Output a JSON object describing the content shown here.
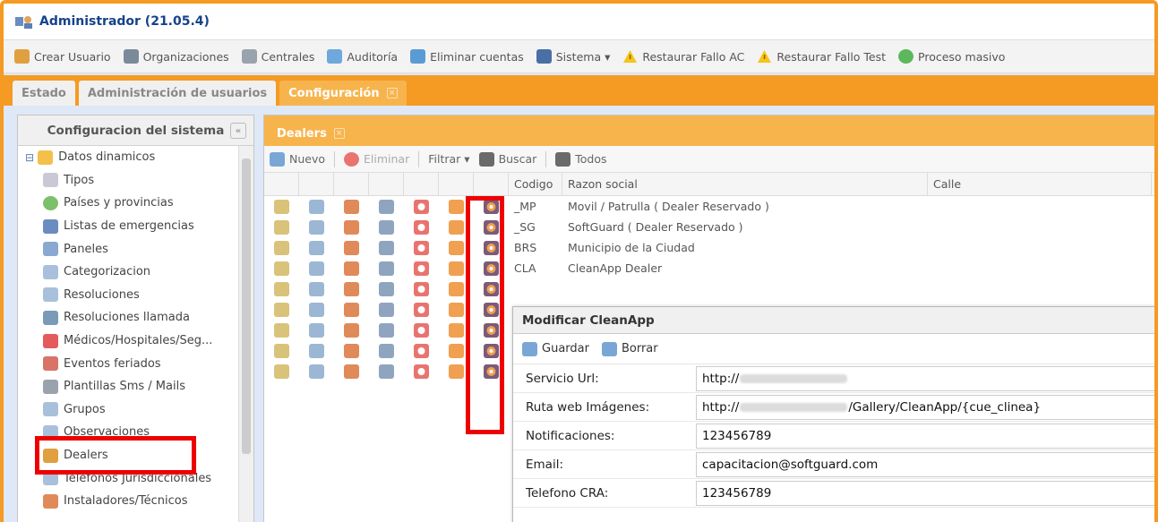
{
  "window": {
    "title": "Administrador (21.05.4)"
  },
  "toolbar": [
    {
      "label": "Crear Usuario",
      "icon": "add-user-icon",
      "color": "#e0a040"
    },
    {
      "label": "Organizaciones",
      "icon": "organization-icon",
      "color": "#7a8a9a"
    },
    {
      "label": "Centrales",
      "icon": "server-icon",
      "color": "#9aa3ad"
    },
    {
      "label": "Auditoría",
      "icon": "audit-icon",
      "color": "#6fa8dc"
    },
    {
      "label": "Eliminar cuentas",
      "icon": "delete-accounts-icon",
      "color": "#5b9bd5"
    },
    {
      "label": "Sistema ▾",
      "icon": "system-icon",
      "color": "#4a6fa5"
    },
    {
      "label": "Restaurar Fallo AC",
      "icon": "warning-icon",
      "color": "#f5c518"
    },
    {
      "label": "Restaurar Fallo Test",
      "icon": "warning-icon",
      "color": "#f5c518"
    },
    {
      "label": "Proceso masivo",
      "icon": "check-circle-icon",
      "color": "#5cb85c"
    }
  ],
  "main_tabs": [
    {
      "label": "Estado"
    },
    {
      "label": "Administración de usuarios"
    },
    {
      "label": "Configuración"
    }
  ],
  "left_panel": {
    "title": "Configuracion del sistema",
    "items": [
      {
        "label": "Datos dinamicos",
        "icon": "folder-icon",
        "indent": 0
      },
      {
        "label": "Tipos",
        "icon": "tag-icon",
        "indent": 1
      },
      {
        "label": "Países y provincias",
        "icon": "globe-icon",
        "indent": 1
      },
      {
        "label": "Listas de emergencias",
        "icon": "list-icon",
        "indent": 1
      },
      {
        "label": "Paneles",
        "icon": "panel-icon",
        "indent": 1
      },
      {
        "label": "Categorizacion",
        "icon": "category-icon",
        "indent": 1
      },
      {
        "label": "Resoluciones",
        "icon": "resolution-icon",
        "indent": 1
      },
      {
        "label": "Resoluciones llamada",
        "icon": "call-resolution-icon",
        "indent": 1
      },
      {
        "label": "Médicos/Hospitales/Seg...",
        "icon": "medical-icon",
        "indent": 1
      },
      {
        "label": "Eventos feriados",
        "icon": "calendar-icon",
        "indent": 1
      },
      {
        "label": "Plantillas Sms / Mails",
        "icon": "template-icon",
        "indent": 1
      },
      {
        "label": "Grupos",
        "icon": "group-icon",
        "indent": 1
      },
      {
        "label": "Observaciones",
        "icon": "note-icon",
        "indent": 1
      },
      {
        "label": "Dealers",
        "icon": "dealer-icon",
        "indent": 1
      },
      {
        "label": "Telefonos Jurisdiccionales",
        "icon": "phone-icon",
        "indent": 1
      },
      {
        "label": "Instaladores/Técnicos",
        "icon": "technician-icon",
        "indent": 1
      }
    ]
  },
  "dealers": {
    "tab": "Dealers",
    "toolbar": {
      "nuevo": "Nuevo",
      "eliminar": "Eliminar",
      "filtrar": "Filtrar ▾",
      "buscar": "Buscar",
      "todos": "Todos"
    },
    "columns": {
      "codigo": "Codigo",
      "razon": "Razon social",
      "calle": "Calle"
    },
    "rows": [
      {
        "codigo": "_MP",
        "razon": "Movil / Patrulla ( Dealer Reservado )"
      },
      {
        "codigo": "_SG",
        "razon": "SoftGuard ( Dealer Reservado )"
      },
      {
        "codigo": "BRS",
        "razon": "Municipio de la Ciudad"
      },
      {
        "codigo": "CLA",
        "razon": "CleanApp Dealer"
      },
      {
        "codigo": "",
        "razon": ""
      },
      {
        "codigo": "",
        "razon": ""
      },
      {
        "codigo": "",
        "razon": ""
      },
      {
        "codigo": "",
        "razon": ""
      },
      {
        "codigo": "",
        "razon": ""
      }
    ],
    "row_icons": [
      {
        "name": "edit-icon",
        "color": "#d9c27a"
      },
      {
        "name": "document-icon",
        "color": "#9bb7d4"
      },
      {
        "name": "user-icon",
        "color": "#e08a5a"
      },
      {
        "name": "device-icon",
        "color": "#8fa5bf"
      },
      {
        "name": "alarm-icon",
        "color": "#e9746f"
      },
      {
        "name": "contact-icon",
        "color": "#f0a050"
      },
      {
        "name": "cleanapp-icon",
        "color": "#7b5a7a"
      }
    ]
  },
  "modal": {
    "title": "Modificar CleanApp",
    "guardar": "Guardar",
    "borrar": "Borrar",
    "fields": [
      {
        "label": "Servicio Url:",
        "prefix": "http://",
        "suffix": ""
      },
      {
        "label": "Ruta web Imágenes:",
        "prefix": "http://",
        "suffix": "/Gallery/CleanApp/{cue_clinea}"
      },
      {
        "label": "Notificaciones:",
        "prefix": "123456789",
        "suffix": ""
      },
      {
        "label": "Email:",
        "prefix": "capacitacion@softguard.com",
        "suffix": ""
      },
      {
        "label": "Telefono CRA:",
        "prefix": "123456789",
        "suffix": ""
      }
    ]
  },
  "colors": {
    "accent": "#f59a23",
    "highlight": "#e00000"
  }
}
